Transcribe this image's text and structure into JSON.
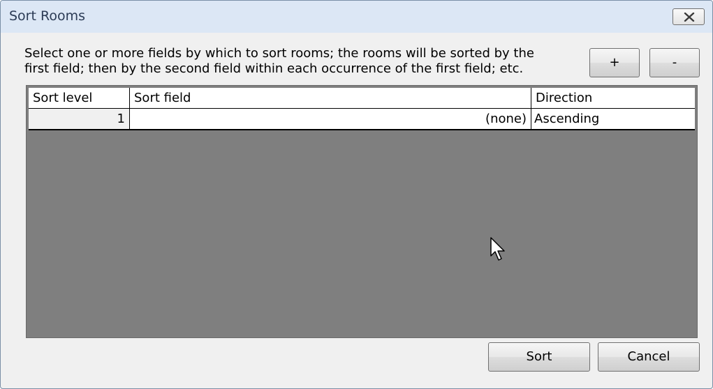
{
  "window": {
    "title": "Sort Rooms",
    "close_icon": "close-x-icon"
  },
  "instructions": {
    "line1": "Select one or more fields by which to sort rooms; the rooms will be sorted by the",
    "line2": "first field; then by the second field within each occurrence of the first field; etc."
  },
  "toolbar": {
    "add_label": "+",
    "remove_label": "-"
  },
  "grid": {
    "columns": [
      "Sort level",
      "Sort field",
      "Direction"
    ],
    "rows": [
      {
        "level": "1",
        "field": "(none)",
        "direction": "Ascending"
      }
    ]
  },
  "actions": {
    "sort_label": "Sort",
    "cancel_label": "Cancel"
  },
  "colors": {
    "titlebar": "#dce7f5",
    "grid_background": "#7f7f7f",
    "dialog_background": "#f0f0f0"
  },
  "pointer_icon": "mouse-pointer-icon"
}
